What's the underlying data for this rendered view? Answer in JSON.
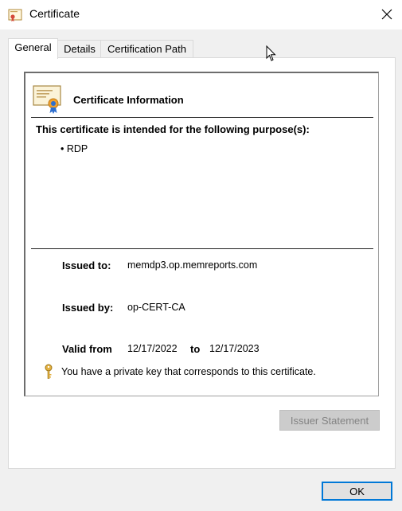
{
  "window": {
    "title": "Certificate",
    "close_icon": "close-icon"
  },
  "tabs": [
    {
      "label": "General",
      "active": true
    },
    {
      "label": "Details",
      "active": false
    },
    {
      "label": "Certification Path",
      "active": false
    }
  ],
  "cert": {
    "info_title": "Certificate Information",
    "purpose_heading": "This certificate is intended for the following purpose(s):",
    "purposes": [
      "RDP"
    ],
    "issued_to_label": "Issued to:",
    "issued_to": "memdp3.op.memreports.com",
    "issued_by_label": "Issued by:",
    "issued_by": "op-CERT-CA",
    "valid_from_label": "Valid from",
    "valid_from": "12/17/2022",
    "to_label": "to",
    "valid_to": "12/17/2023",
    "private_key_note": "You have a private key that corresponds to this certificate."
  },
  "buttons": {
    "issuer_statement": "Issuer Statement",
    "ok": "OK"
  },
  "colors": {
    "ok_border": "#0078d7",
    "disabled_text": "#838383"
  }
}
